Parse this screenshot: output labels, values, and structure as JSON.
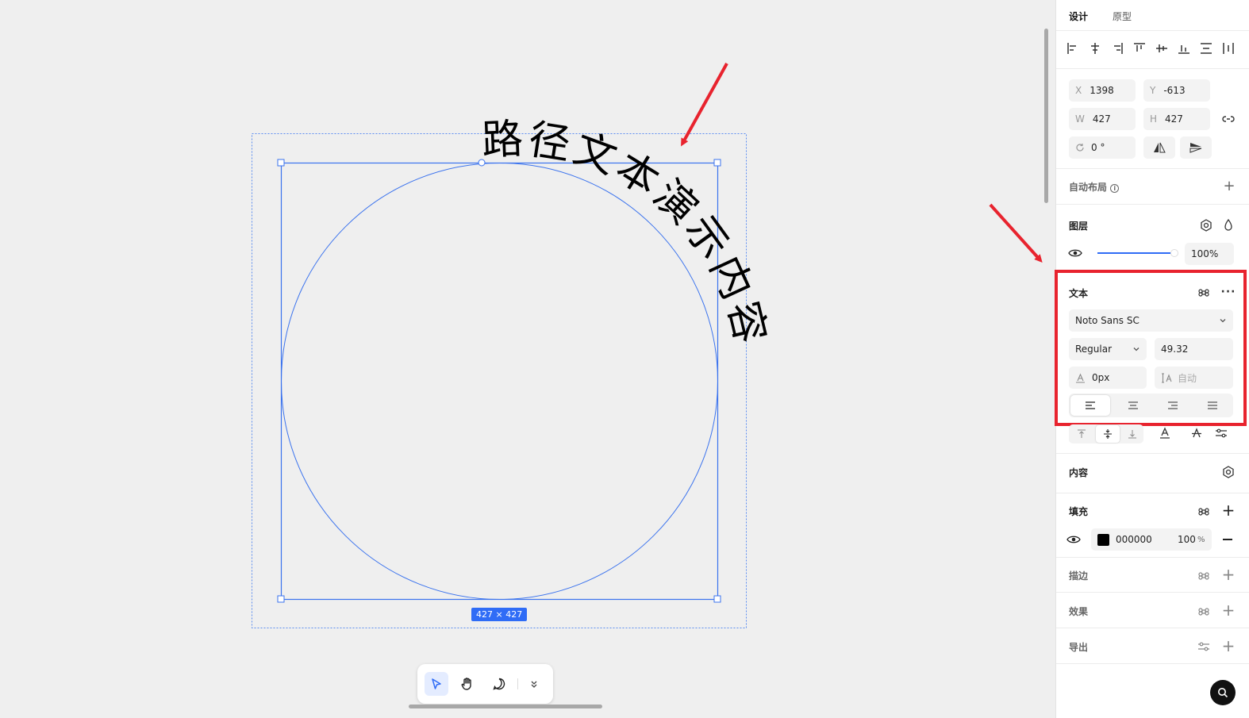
{
  "canvas": {
    "path_text": "路径文本演示内容",
    "size_badge": "427 × 427",
    "accent": "#2f6cf6"
  },
  "toolbar": {
    "tools": [
      "select-tool",
      "hand-tool",
      "comment-tool",
      "more-tools"
    ]
  },
  "panel": {
    "tabs": {
      "design": "设计",
      "prototype": "原型"
    },
    "position": {
      "x_label": "X",
      "x": "1398",
      "y_label": "Y",
      "y": "-613",
      "w_label": "W",
      "w": "427",
      "h_label": "H",
      "h": "427",
      "rotation": "0 °"
    },
    "auto_layout": "自动布局",
    "layer": {
      "title": "图层",
      "opacity": "100%"
    },
    "text": {
      "title": "文本",
      "font_family": "Noto Sans SC",
      "font_weight": "Regular",
      "font_size": "49.32",
      "letter_spacing": "0px",
      "line_height_placeholder": "自动"
    },
    "content": "内容",
    "fill": {
      "title": "填充",
      "color": "000000",
      "opacity": "100",
      "opacity_unit": "%",
      "swatch": "#000000"
    },
    "stroke": "描边",
    "effect": "效果",
    "export": "导出"
  },
  "annotations": {
    "highlight_color": "#e8232e"
  }
}
